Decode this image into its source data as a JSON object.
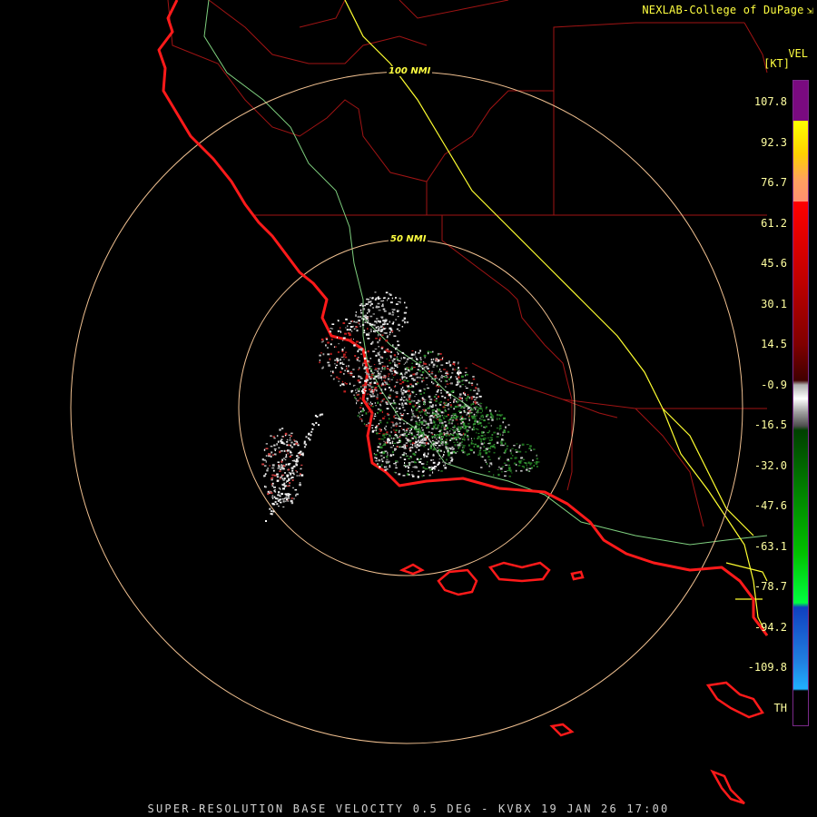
{
  "credit": {
    "text": "NEXLAB-College of DuPage",
    "mark": "⇲"
  },
  "footer": "SUPER-RESOLUTION BASE VELOCITY 0.5 DEG - KVBX 19 JAN 26 17:00",
  "range_rings": [
    {
      "label": "100 NMI"
    },
    {
      "label": "50 NMI"
    }
  ],
  "legend": {
    "title": "VEL",
    "unit": "[KT]",
    "ticks": [
      "107.8",
      "92.3",
      "76.7",
      "61.2",
      "45.6",
      "30.1",
      "14.5",
      "-0.9",
      "-16.5",
      "-32.0",
      "-47.6",
      "-63.1",
      "-78.7",
      "-94.2",
      "-109.8",
      "TH"
    ]
  },
  "colors": {
    "coastline": "#ff1a1a",
    "county_lines": "#b01010",
    "state_roads": "#7fd07f",
    "interstate": "#ffff30",
    "range_rings": "#f0c090",
    "credit_text": "#ffff40"
  }
}
